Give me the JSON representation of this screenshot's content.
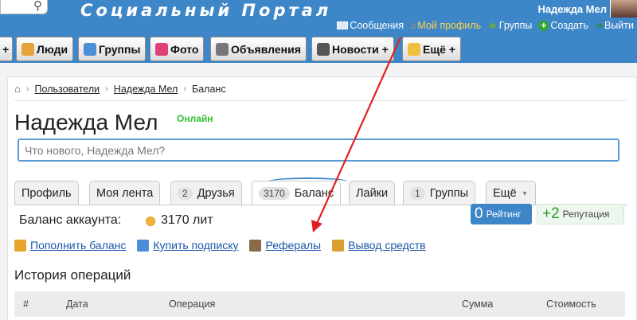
{
  "header": {
    "search_icon": "search-icon",
    "portal_title": "Социальный Портал",
    "user_name": "Надежда Мел",
    "links": [
      {
        "label": "Сообщения",
        "icon": "envelope-icon"
      },
      {
        "label": "Мой профиль",
        "icon": "house-icon"
      },
      {
        "label": "Группы",
        "icon": "group-icon"
      },
      {
        "label": "Создать",
        "icon": "plus-icon"
      },
      {
        "label": "Выйти",
        "icon": "exit-icon"
      }
    ]
  },
  "nav": {
    "plus_left": "+",
    "tabs": [
      {
        "label": "Люди",
        "icon": "people-icon"
      },
      {
        "label": "Группы",
        "icon": "groups-icon"
      },
      {
        "label": "Фото",
        "icon": "photo-icon"
      },
      {
        "label": "Объявления",
        "icon": "ads-icon"
      },
      {
        "label": "Новости +",
        "icon": "news-icon"
      },
      {
        "label": "Ещё +",
        "icon": "more-icon"
      }
    ]
  },
  "breadcrumb": [
    "Пользователи",
    "Надежда Мел",
    "Баланс"
  ],
  "profile": {
    "name": "Надежда Мел",
    "status": "Онлайн",
    "input_placeholder": "Что нового, Надежда Мел?"
  },
  "tabs": [
    {
      "label": "Профиль",
      "count": ""
    },
    {
      "label": "Моя лента",
      "count": ""
    },
    {
      "label": "Друзья",
      "count": "2"
    },
    {
      "label": "Баланс",
      "count": "3170"
    },
    {
      "label": "Лайки",
      "count": ""
    },
    {
      "label": "Группы",
      "count": "1"
    },
    {
      "label": "Ещё",
      "count": ""
    }
  ],
  "balance": {
    "label": "Баланс аккаунта:",
    "value": "3170 лит"
  },
  "stats": {
    "rating_value": "0",
    "rating_label": "Рейтинг",
    "rep_value": "+2",
    "rep_label": "Репутация"
  },
  "actions": [
    {
      "label": "Пополнить баланс",
      "icon": "coins-add-icon"
    },
    {
      "label": "Купить подписку",
      "icon": "subscription-icon"
    },
    {
      "label": "Рефералы",
      "icon": "referrals-icon"
    },
    {
      "label": "Вывод средств",
      "icon": "withdraw-icon"
    }
  ],
  "history": {
    "title": "История операций",
    "columns": [
      "#",
      "Дата",
      "Операция",
      "Сумма",
      "Стоимость"
    ]
  },
  "colors": {
    "header_blue": "#3d86c8",
    "link_blue": "#1a56a8",
    "online_green": "#2fbf2f",
    "annotation_red": "#e02020"
  }
}
